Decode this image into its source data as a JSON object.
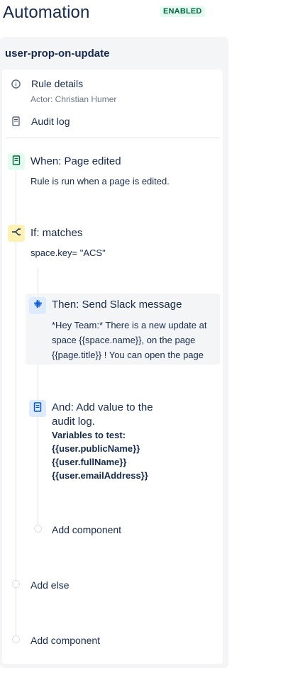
{
  "header": {
    "title": "Automation",
    "status": "ENABLED"
  },
  "rule": {
    "name": "user-prop-on-update"
  },
  "sidebar": {
    "rule_details": {
      "label": "Rule details",
      "actor": "Actor: Christian Humer"
    },
    "audit_log": {
      "label": "Audit log"
    }
  },
  "components": {
    "trigger": {
      "title": "When: Page edited",
      "description": "Rule is run when a page is edited."
    },
    "condition": {
      "title": "If: matches",
      "description": "space.key= \"ACS\""
    },
    "slack": {
      "title": "Then: Send Slack message",
      "lines": [
        "*Hey Team:* There is a new update at",
        "space {{space.name}}, on the page",
        "{{page.title}} ! You can open the page"
      ]
    },
    "audit": {
      "title_line1": "And: Add value to the",
      "title_line2": "audit log.",
      "lines": [
        "Variables to test:",
        "{{user.publicName}}",
        "{{user.fullName}}",
        "{{user.emailAddress}}"
      ]
    },
    "add_component_inner": "Add component",
    "add_else": "Add else",
    "add_component_outer": "Add component"
  },
  "colors": {
    "trigger_bg": "#e3fcef",
    "trigger_fg": "#006644",
    "condition_bg": "#fff0b3",
    "condition_fg": "#172b4d",
    "action_bg": "#deebff",
    "action_fg": "#0052cc",
    "badge_bg": "#e3fcef",
    "badge_fg": "#006644"
  },
  "icons": {
    "rule_details": "info-icon",
    "audit_log": "document-icon",
    "trigger": "page-icon",
    "condition": "branch-icon",
    "slack": "slack-icon",
    "audit": "log-icon"
  }
}
